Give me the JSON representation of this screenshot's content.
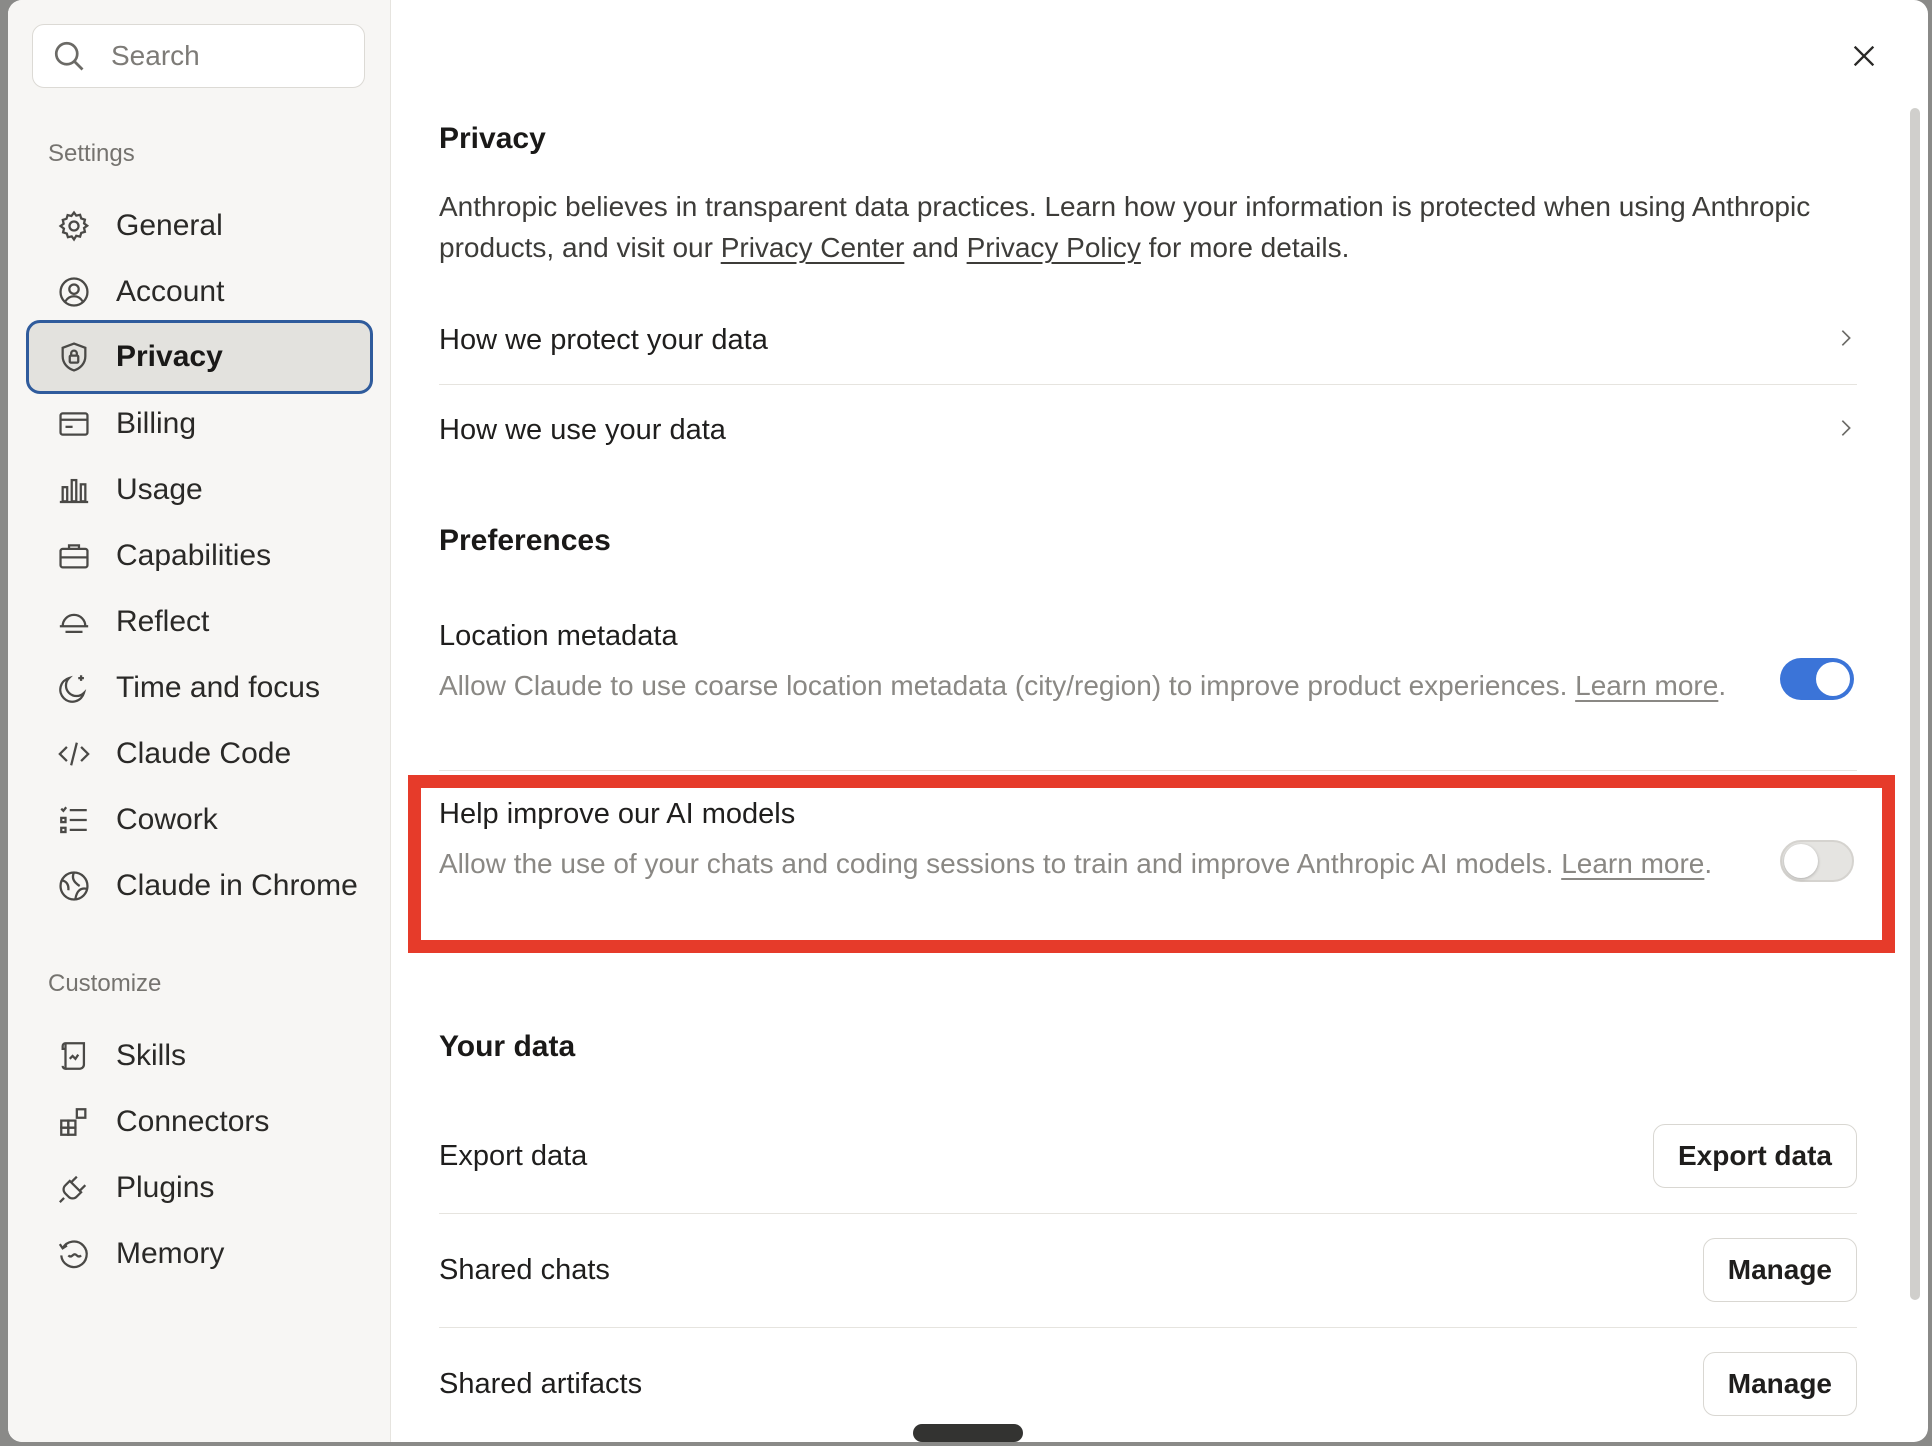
{
  "search": {
    "placeholder": "Search"
  },
  "sidebar": {
    "settings_label": "Settings",
    "customize_label": "Customize",
    "settings_items": [
      {
        "label": "General",
        "icon": "gear-icon"
      },
      {
        "label": "Account",
        "icon": "user-circle-icon"
      },
      {
        "label": "Privacy",
        "icon": "shield-lock-icon",
        "active": true
      },
      {
        "label": "Billing",
        "icon": "credit-card-icon"
      },
      {
        "label": "Usage",
        "icon": "bar-chart-icon"
      },
      {
        "label": "Capabilities",
        "icon": "briefcase-icon"
      },
      {
        "label": "Reflect",
        "icon": "sunrise-icon"
      },
      {
        "label": "Time and focus",
        "icon": "moon-icon"
      },
      {
        "label": "Claude Code",
        "icon": "code-icon"
      },
      {
        "label": "Cowork",
        "icon": "list-icon"
      },
      {
        "label": "Claude in Chrome",
        "icon": "globe-icon"
      }
    ],
    "customize_items": [
      {
        "label": "Skills",
        "icon": "scroll-icon"
      },
      {
        "label": "Connectors",
        "icon": "blocks-icon"
      },
      {
        "label": "Plugins",
        "icon": "plug-icon"
      },
      {
        "label": "Memory",
        "icon": "memory-icon"
      }
    ]
  },
  "main": {
    "privacy": {
      "title": "Privacy",
      "intro_before": "Anthropic believes in transparent data practices. Learn how your information is protected when using Anthropic products, and visit our ",
      "privacy_center_link": "Privacy Center",
      "intro_and": " and ",
      "privacy_policy_link": "Privacy Policy",
      "intro_after": " for more details.",
      "links": [
        {
          "label": "How we protect your data"
        },
        {
          "label": "How we use your data"
        }
      ]
    },
    "preferences": {
      "title": "Preferences",
      "location": {
        "title": "Location metadata",
        "desc": "Allow Claude to use coarse location metadata (city/region) to improve product experiences. ",
        "learn_more": "Learn more",
        "period": ".",
        "enabled": true
      },
      "help_improve": {
        "title": "Help improve our AI models",
        "desc": "Allow the use of your chats and coding sessions to train and improve Anthropic AI models. ",
        "learn_more": "Learn more",
        "period": ".",
        "enabled": false
      }
    },
    "your_data": {
      "title": "Your data",
      "rows": [
        {
          "label": "Export data",
          "button": "Export data"
        },
        {
          "label": "Shared chats",
          "button": "Manage"
        },
        {
          "label": "Shared artifacts",
          "button": "Manage"
        }
      ]
    }
  },
  "colors": {
    "accent": "#3b74d8",
    "active_border": "#2f5b9c",
    "highlight": "#e63b2a"
  }
}
